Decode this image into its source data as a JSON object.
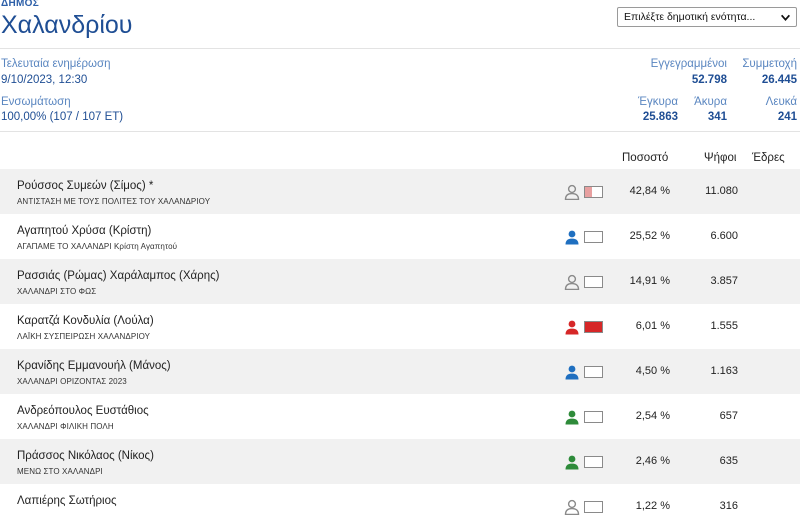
{
  "header": {
    "dimos_label": "ΔΗΜΟΣ",
    "dimos_name": "Χαλανδρίου",
    "unit_select_value": "Επιλέξτε δημοτική ενότητα...",
    "chevron_icon": "chevron-down-icon"
  },
  "meta": {
    "last_update_label": "Τελευταία ενημέρωση",
    "last_update_value": "9/10/2023, 12:30",
    "integration_label": "Ενσωμάτωση",
    "integration_value": "100,00% (107 / 107 ΕΤ)",
    "registered_label": "Εγγεγραμμένοι",
    "registered_value": "52.798",
    "turnout_label": "Συμμετοχή",
    "turnout_value": "26.445",
    "valid_label": "Έγκυρα",
    "valid_value": "25.863",
    "invalid_label": "Άκυρα",
    "invalid_value": "341",
    "blank_label": "Λευκά",
    "blank_value": "241"
  },
  "columns": {
    "percent": "Ποσοστό",
    "votes": "Ψήφοι",
    "seats": "Έδρες"
  },
  "candidates": [
    {
      "name": "Ρούσσος Συμεών (Σίμος) *",
      "party": "ΑΝΤΙΣΤΑΣΗ ΜΕ ΤΟΥΣ ΠΟΛΙΤΕΣ ΤΟΥ ΧΑΛΑΝΔΡΙΟΥ",
      "percent": "42,84 %",
      "votes": "11.080",
      "icon_color": "#8a8a8a",
      "icon_outline": true,
      "box_fill_color": "#e8a0a0",
      "box_fill_fraction": 0.4284
    },
    {
      "name": "Αγαπητού Χρύσα (Κρίστη)",
      "party": "ΑΓΑΠΑΜΕ ΤΟ ΧΑΛΑΝΔΡΙ Κρίστη Αγαπητού",
      "percent": "25,52 %",
      "votes": "6.600",
      "icon_color": "#1f6fc0",
      "icon_outline": false,
      "box_fill_color": "#ffffff",
      "box_fill_fraction": 0
    },
    {
      "name": "Ρασσιάς (Ρώμας) Χαράλαμπος (Χάρης)",
      "party": "ΧΑΛΑΝΔΡΙ ΣΤΟ ΦΩΣ",
      "percent": "14,91 %",
      "votes": "3.857",
      "icon_color": "#8a8a8a",
      "icon_outline": true,
      "box_fill_color": "#ffffff",
      "box_fill_fraction": 0
    },
    {
      "name": "Καρατζά Κονδυλία (Λούλα)",
      "party": "ΛΑΪΚΗ ΣΥΣΠΕΙΡΩΣΗ ΧΑΛΑΝΔΡΙΟΥ",
      "percent": "6,01 %",
      "votes": "1.555",
      "icon_color": "#d62728",
      "icon_outline": false,
      "box_fill_color": "#d62728",
      "box_fill_fraction": 1
    },
    {
      "name": "Κρανίδης Εμμανουήλ (Μάνος)",
      "party": "ΧΑΛΑΝΔΡΙ ΟΡΙΖΟΝΤΑΣ 2023",
      "percent": "4,50 %",
      "votes": "1.163",
      "icon_color": "#1f6fc0",
      "icon_outline": false,
      "box_fill_color": "#ffffff",
      "box_fill_fraction": 0
    },
    {
      "name": "Ανδρεόπουλος Ευστάθιος",
      "party": "ΧΑΛΑΝΔΡΙ ΦΙΛΙΚΗ ΠΟΛΗ",
      "percent": "2,54 %",
      "votes": "657",
      "icon_color": "#2e8b3a",
      "icon_outline": false,
      "box_fill_color": "#ffffff",
      "box_fill_fraction": 0
    },
    {
      "name": "Πράσσος Νικόλαος (Νίκος)",
      "party": "ΜΕΝΩ ΣΤΟ ΧΑΛΑΝΔΡΙ",
      "percent": "2,46 %",
      "votes": "635",
      "icon_color": "#2e8b3a",
      "icon_outline": false,
      "box_fill_color": "#ffffff",
      "box_fill_fraction": 0
    },
    {
      "name": "Λαπιέρης Σωτήριος",
      "party": "",
      "percent": "1,22 %",
      "votes": "316",
      "icon_color": "#8a8a8a",
      "icon_outline": true,
      "box_fill_color": "#ffffff",
      "box_fill_fraction": 0
    }
  ]
}
